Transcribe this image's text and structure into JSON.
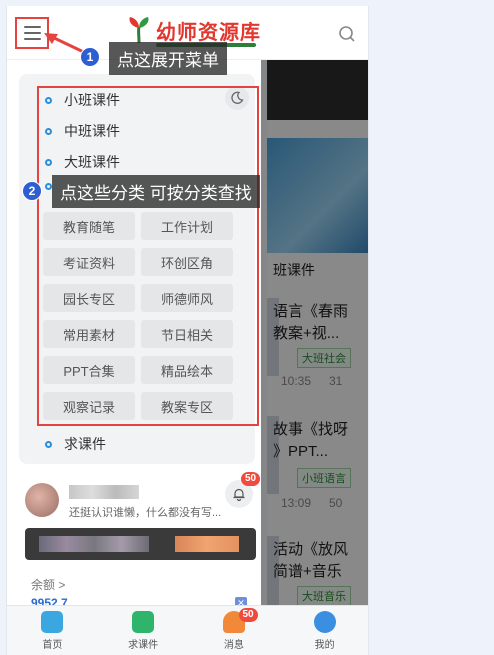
{
  "header": {
    "logo_text": "幼师资源库",
    "menu_label": "menu-icon",
    "search_label": "search-icon"
  },
  "drawer": {
    "categories": [
      "小班课件",
      "中班课件",
      "大班课件"
    ],
    "grid": [
      "教育随笔",
      "工作计划",
      "考证资料",
      "环创区角",
      "园长专区",
      "师德师风",
      "常用素材",
      "节日相关",
      "PPT合集",
      "精品绘本",
      "观察记录",
      "教案专区"
    ],
    "extra_item": "求课件",
    "user": {
      "bio": "还挺认识谁懒，什么都没有写...",
      "notification_badge": "50"
    },
    "balance": {
      "label": "余额 >",
      "value": "9952.7"
    }
  },
  "background": {
    "section": "班课件",
    "items": [
      {
        "line1": "语言《春雨",
        "line2": "教案+视...",
        "tag": "大班社会",
        "time": "10:35",
        "views": "31"
      },
      {
        "line1": "故事《找呀",
        "line2": "》PPT...",
        "tag": "小班语言",
        "time": "13:09",
        "views": "50"
      },
      {
        "line1": "活动《放风",
        "line2": "简谱+音乐",
        "tag": "大班音乐",
        "time": "",
        "views": ""
      }
    ]
  },
  "bottom_nav": [
    {
      "label": "首页",
      "color": "#3aa7e0"
    },
    {
      "label": "求课件",
      "color": "#2fb46b"
    },
    {
      "label": "消息",
      "color": "#f2883a",
      "badge": "50"
    },
    {
      "label": "我的",
      "color": "#3a8fe0"
    }
  ],
  "annotations": {
    "tip1": "点这展开菜单",
    "tip1_num": "1",
    "tip2": "点这些分类 可按分类查找",
    "tip2_num": "2"
  }
}
